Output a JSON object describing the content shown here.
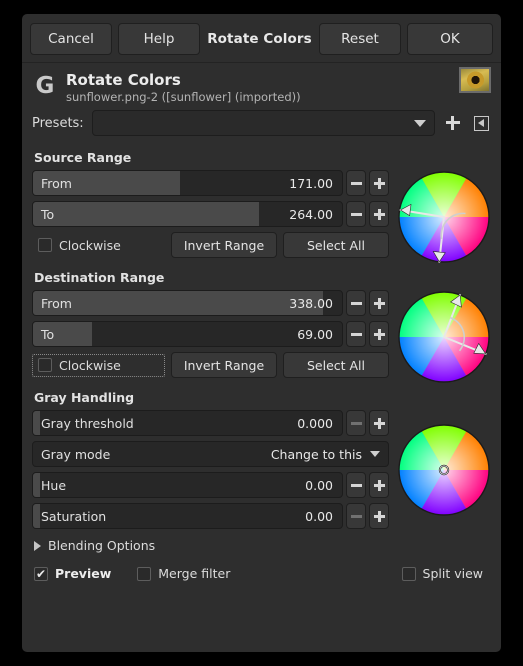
{
  "titlebar": {
    "cancel_label": "Cancel",
    "help_label": "Help",
    "title": "Rotate Colors",
    "reset_label": "Reset",
    "ok_label": "OK"
  },
  "identity": {
    "icon": "gegl-g-icon",
    "title": "Rotate Colors",
    "subtitle": "sunflower.png-2 ([sunflower] (imported))",
    "thumbnail": "sunflower-thumbnail"
  },
  "presets": {
    "label": "Presets:",
    "value": "",
    "add_icon": "plus-icon",
    "menu_icon": "preset-menu-icon"
  },
  "source_range": {
    "title": "Source Range",
    "from": {
      "label": "From",
      "value": "171.00",
      "fill_pct": 47.5
    },
    "to": {
      "label": "To",
      "value": "264.00",
      "fill_pct": 73.3
    },
    "clockwise": {
      "label": "Clockwise",
      "checked": false
    },
    "invert_label": "Invert Range",
    "select_all_label": "Select All",
    "wheel": {
      "from_angle": 171,
      "to_angle": 264
    }
  },
  "destination_range": {
    "title": "Destination Range",
    "from": {
      "label": "From",
      "value": "338.00",
      "fill_pct": 93.9
    },
    "to": {
      "label": "To",
      "value": "69.00",
      "fill_pct": 19.2
    },
    "clockwise": {
      "label": "Clockwise",
      "checked": false
    },
    "invert_label": "Invert Range",
    "select_all_label": "Select All",
    "wheel": {
      "from_angle": 338,
      "to_angle": 69
    }
  },
  "gray_handling": {
    "title": "Gray Handling",
    "threshold": {
      "label": "Gray threshold",
      "value": "0.000",
      "fill_pct": 0
    },
    "mode": {
      "label": "Gray mode",
      "value": "Change to this"
    },
    "hue": {
      "label": "Hue",
      "value": "0.00",
      "fill_pct": 0
    },
    "saturation": {
      "label": "Saturation",
      "value": "0.00",
      "fill_pct": 0
    }
  },
  "footer": {
    "blending_options_label": "Blending Options",
    "preview": {
      "label": "Preview",
      "checked": true
    },
    "merge_filter": {
      "label": "Merge filter",
      "checked": false
    },
    "split_view": {
      "label": "Split view",
      "checked": false
    }
  },
  "colors": {
    "dialog_bg": "#2e2e2e",
    "button_bg": "#383838",
    "field_bg": "#272727",
    "fill": "#4a4a4a",
    "text": "#dcdcdc"
  }
}
